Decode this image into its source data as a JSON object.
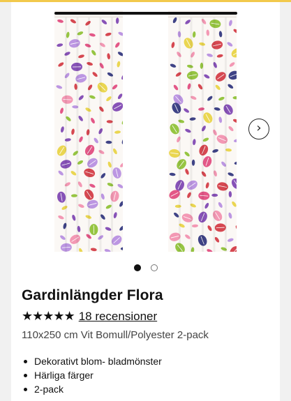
{
  "product": {
    "title": "Gardinlängder Flora",
    "rating_stars": "★★★★★",
    "rating_value": 5,
    "reviews_link": "18 recensioner",
    "subtitle": "110x250 cm Vit Bomull/Polyester 2-pack",
    "features": [
      "Dekorativt blom- bladmönster",
      "Härliga färger",
      "2-pack"
    ]
  },
  "gallery": {
    "image_label": "curtain-pair",
    "next_icon": "chevron-right-icon",
    "next_glyph": "›",
    "pagination": {
      "total": 2,
      "active": 1
    }
  },
  "colors": {
    "pattern": [
      "#7a3fb0",
      "#e0457b",
      "#8bbf2f",
      "#e8d23f",
      "#2a2f7a",
      "#d2343f",
      "#f28dad",
      "#b58be0"
    ]
  }
}
